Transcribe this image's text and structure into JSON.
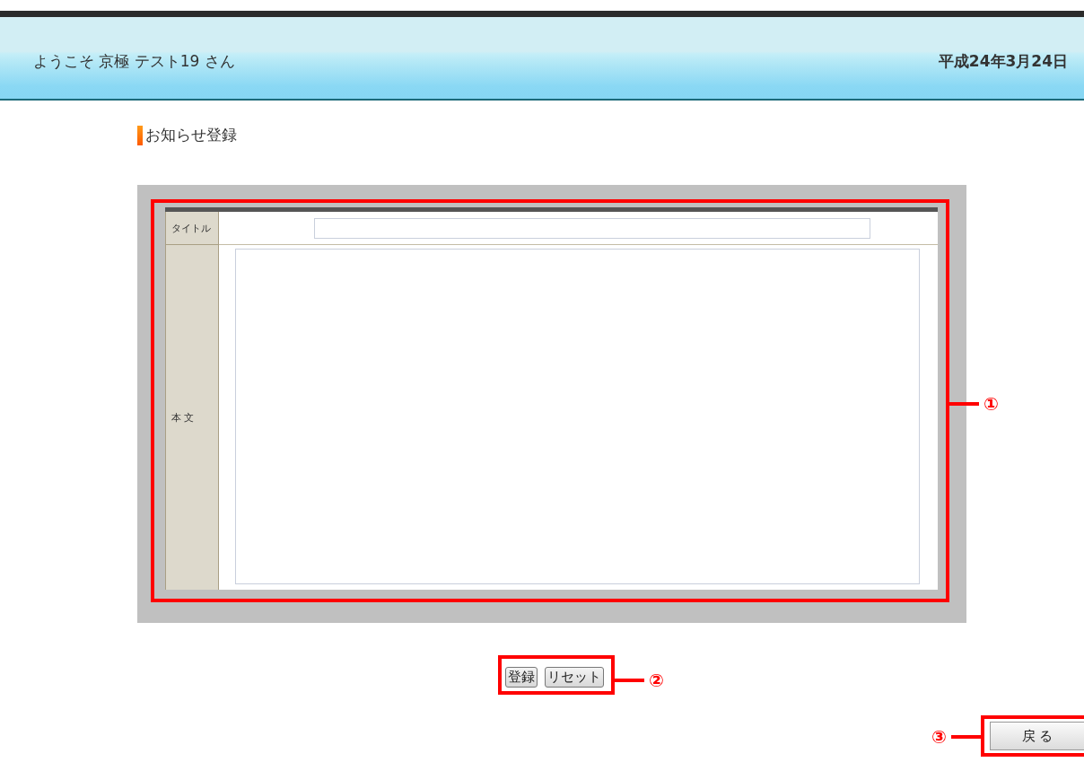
{
  "header": {
    "welcome": "ようこそ 京極  テスト19 さん",
    "date": "平成24年3月24日"
  },
  "heading": "お知らせ登録",
  "form": {
    "callout": "①",
    "fields": [
      {
        "label": "タイトル",
        "kind": "text"
      },
      {
        "label": "本 文",
        "kind": "textarea"
      }
    ]
  },
  "actions": {
    "callout": "②",
    "buttons": [
      "登録",
      "リセット"
    ]
  },
  "back": {
    "callout": "③",
    "label": "戻 る"
  }
}
